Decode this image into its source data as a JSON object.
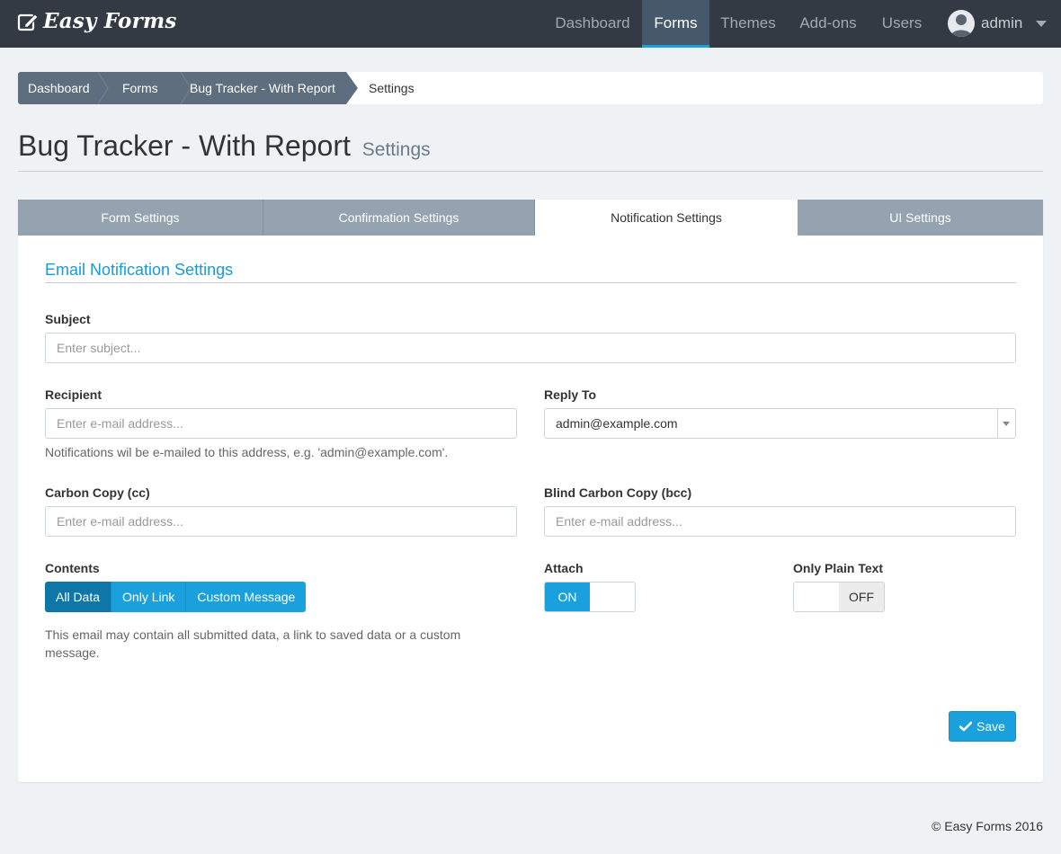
{
  "brand": {
    "name": "Easy Forms"
  },
  "nav": {
    "items": [
      {
        "label": "Dashboard"
      },
      {
        "label": "Forms"
      },
      {
        "label": "Themes"
      },
      {
        "label": "Add-ons"
      },
      {
        "label": "Users"
      }
    ],
    "active": "Forms",
    "user": "admin"
  },
  "breadcrumb": {
    "items": [
      "Dashboard",
      "Forms",
      "Bug Tracker - With Report"
    ],
    "current": "Settings"
  },
  "page": {
    "title": "Bug Tracker - With Report",
    "subtitle": "Settings"
  },
  "tabs": [
    {
      "label": "Form Settings"
    },
    {
      "label": "Confirmation Settings"
    },
    {
      "label": "Notification Settings"
    },
    {
      "label": "UI Settings"
    }
  ],
  "active_tab": "Notification Settings",
  "form": {
    "section_title": "Email Notification Settings",
    "subject": {
      "label": "Subject",
      "placeholder": "Enter subject..."
    },
    "recipient": {
      "label": "Recipient",
      "placeholder": "Enter e-mail address...",
      "help": "Notifications wil be e-mailed to this address, e.g. 'admin@example.com'."
    },
    "reply_to": {
      "label": "Reply To",
      "value": "admin@example.com"
    },
    "cc": {
      "label": "Carbon Copy (cc)",
      "placeholder": "Enter e-mail address..."
    },
    "bcc": {
      "label": "Blind Carbon Copy (bcc)",
      "placeholder": "Enter e-mail address..."
    },
    "contents": {
      "label": "Contents",
      "options": [
        "All Data",
        "Only Link",
        "Custom Message"
      ],
      "selected": "All Data",
      "help": "This email may contain all submitted data, a link to saved data or a custom message."
    },
    "attach": {
      "label": "Attach",
      "state": "ON"
    },
    "plain_text": {
      "label": "Only Plain Text",
      "state": "OFF"
    },
    "save_label": "Save"
  },
  "footer": {
    "text": "© Easy Forms 2016"
  },
  "colors": {
    "navbar": "#333a43",
    "accent": "#1aa1dd",
    "active_segment": "#0f77a8",
    "breadcrumb": "#5e6e7e",
    "tab_inactive": "#95a3b0"
  }
}
